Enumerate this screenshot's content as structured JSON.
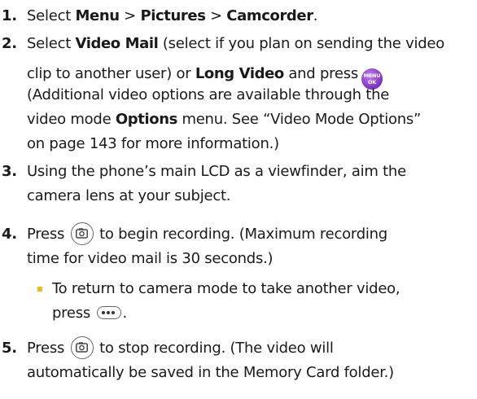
{
  "steps": [
    {
      "num": "1.",
      "lines": [
        {
          "a": "Select ",
          "b1": "Menu",
          "c": " > ",
          "b2": "Pictures",
          "d": " > ",
          "b3": "Camcorder",
          "e": "."
        }
      ]
    },
    {
      "num": "2.",
      "lines": [
        {
          "a": "Select ",
          "b1": "Video Mail",
          "c": " (select if you plan on sending the video"
        },
        {
          "a": "clip to another user) or ",
          "b1": "Long Video",
          "c": " and press"
        },
        {
          "a": "(Additional video options are available through the"
        },
        {
          "a": "video mode ",
          "b1": "Options",
          "c": " menu. See “Video Mode Options”"
        },
        {
          "a": "on page 143 for more information.)"
        }
      ]
    },
    {
      "num": "3.",
      "lines": [
        {
          "a": "Using the phone’s main LCD as a viewfinder, aim the"
        },
        {
          "a": "camera lens at your subject."
        }
      ]
    },
    {
      "num": "4.",
      "lines": [
        {
          "a": "Press",
          "b": "to begin recording. (Maximum recording"
        },
        {
          "a": "time for video mail is 30 seconds.)"
        }
      ]
    },
    {
      "num": "5.",
      "lines": [
        {
          "a": "Press",
          "b": "to stop recording. (The video will"
        },
        {
          "a": "automatically be saved in the Memory Card folder.)"
        }
      ]
    }
  ],
  "sub_bullet": {
    "line1": "To return to camera mode to take another video,",
    "line2": "press"
  },
  "icons": {
    "menu_ok_top": "MENU",
    "menu_ok_bottom": "OK",
    "menu_ok_name": "menu-ok-key-icon",
    "camera_key": "camera-key-icon",
    "more_key": "more-key-icon"
  },
  "colors": {
    "bullet": "#f2b91b",
    "menu_key": "#8a3ad0"
  }
}
